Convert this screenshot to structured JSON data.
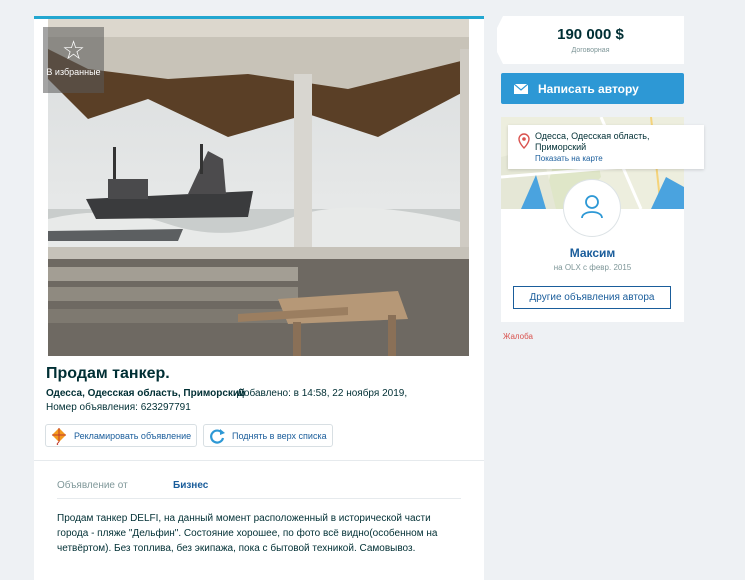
{
  "listing": {
    "favorite_label": "В избранные",
    "title": "Продам танкер.",
    "location": "Одесса, Одесская область, Приморский",
    "added": "Добавлено: в 14:58, 22 ноября 2019,",
    "ad_number": "Номер объявления: 623297791",
    "promote_label": "Рекламировать объявление",
    "raise_label": "Поднять в верх списка",
    "from_label": "Объявление от",
    "from_value": "Бизнес",
    "description": "Продам танкер DELFI, на данный момент расположенный в исторической части города - пляже \"Дельфин\". Состояние хорошее, по фото всё видно(особенном на четвёртом). Без топлива, без экипажа, пока с бытовой техникой. Самовывоз."
  },
  "sidebar": {
    "price": "190 000 $",
    "negotiable": "Договорная",
    "message_button": "Написать автору",
    "location_line1": "Одесса, Одесская область,",
    "location_line2": "Приморский",
    "show_on_map": "Показать на карте",
    "seller_name": "Максим",
    "seller_since": "на OLX с февр. 2015",
    "other_ads_button": "Другие объявления автора",
    "complaint": "Жалоба"
  },
  "colors": {
    "accent": "#2d98d5",
    "link": "#1a5d9b",
    "top_border": "#23a7d0",
    "complaint": "#d9534f"
  },
  "icons": [
    "star-icon",
    "kite-icon",
    "refresh-icon",
    "envelope-icon",
    "map-pin-icon",
    "user-icon"
  ]
}
